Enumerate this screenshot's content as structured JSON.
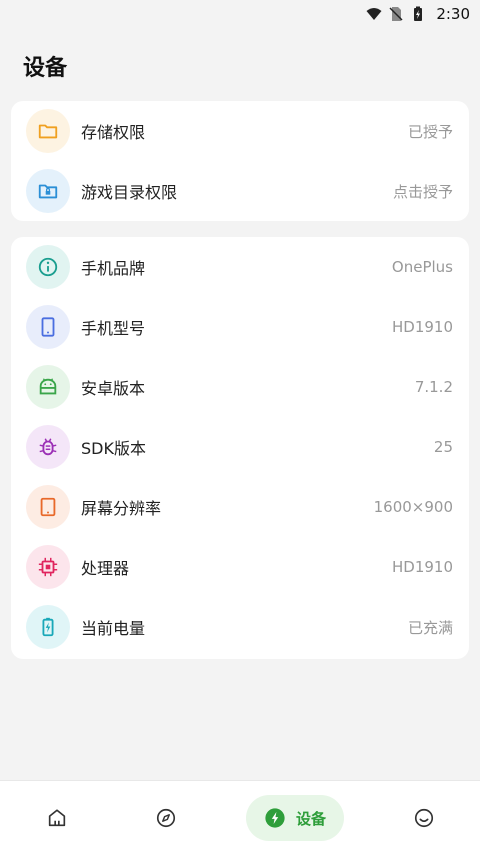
{
  "status_bar": {
    "time": "2:30"
  },
  "page": {
    "title": "设备"
  },
  "permissions": [
    {
      "label": "存储权限",
      "value": "已授予",
      "icon": "folder-icon",
      "color": "#f0a020",
      "bg": "#fdf3e2"
    },
    {
      "label": "游戏目录权限",
      "value": "点击授予",
      "icon": "folder-lock-icon",
      "color": "#2b8fd6",
      "bg": "#e4f1fb"
    }
  ],
  "device_info": [
    {
      "label": "手机品牌",
      "value": "OnePlus",
      "icon": "info-icon",
      "color": "#1a9e8f",
      "bg": "#e1f4f1"
    },
    {
      "label": "手机型号",
      "value": "HD1910",
      "icon": "phone-icon",
      "color": "#4a6ee0",
      "bg": "#e8edfb"
    },
    {
      "label": "安卓版本",
      "value": "7.1.2",
      "icon": "android-icon",
      "color": "#3aa54a",
      "bg": "#e6f5e8"
    },
    {
      "label": "SDK版本",
      "value": "25",
      "icon": "bug-icon",
      "color": "#9b2fb5",
      "bg": "#f4e6f8"
    },
    {
      "label": "屏幕分辨率",
      "value": "1600×900",
      "icon": "tablet-icon",
      "color": "#e8692a",
      "bg": "#fdece3"
    },
    {
      "label": "处理器",
      "value": "HD1910",
      "icon": "chip-icon",
      "color": "#e0245e",
      "bg": "#fce5ec"
    },
    {
      "label": "当前电量",
      "value": "已充满",
      "icon": "battery-charging-icon",
      "color": "#19a8b8",
      "bg": "#e0f5f7"
    }
  ],
  "bottom_nav": {
    "items": [
      {
        "icon": "home-icon"
      },
      {
        "icon": "compass-icon"
      },
      {
        "icon": "bolt-icon",
        "label": "设备",
        "active": true,
        "accent": "#2e9e3a"
      },
      {
        "icon": "smile-icon"
      }
    ]
  }
}
